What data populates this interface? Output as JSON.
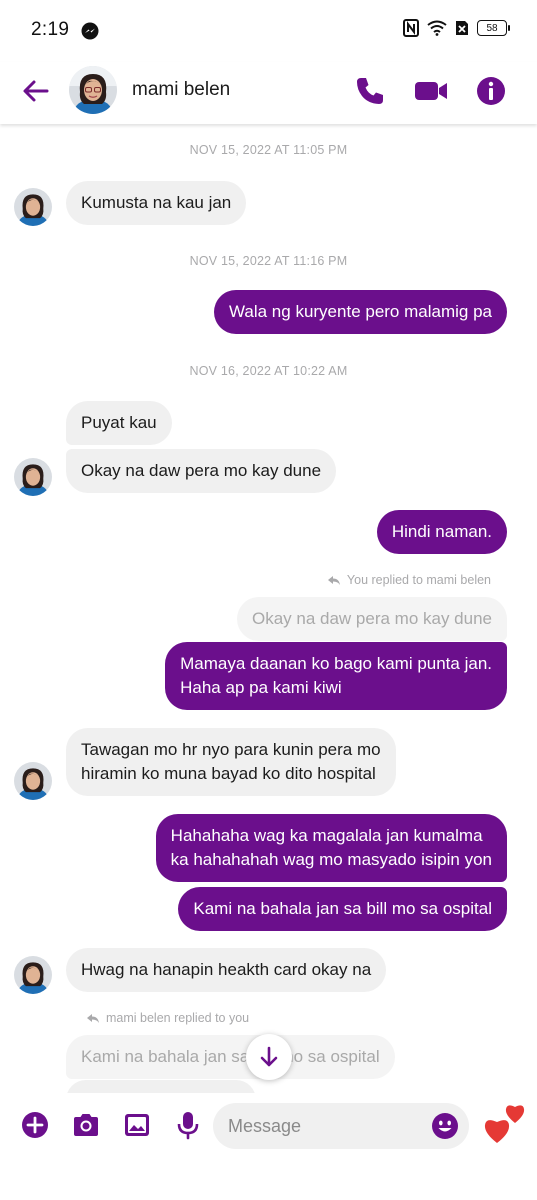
{
  "status_bar": {
    "time": "2:19",
    "battery": "58"
  },
  "header": {
    "contact_name": "mami belen"
  },
  "colors": {
    "accent": "#6b0f8c",
    "incoming_bubble": "#f0f0f0",
    "timestamp": "#a9a9ab"
  },
  "conversation": {
    "timestamps": [
      "NOV 15, 2022 AT 11:05 PM",
      "NOV 15, 2022 AT 11:16 PM",
      "NOV 16, 2022 AT 10:22 AM"
    ],
    "messages": [
      {
        "from": "contact",
        "text": "Kumusta na kau jan"
      },
      {
        "from": "me",
        "text": "Wala ng kuryente pero malamig pa"
      },
      {
        "from": "contact",
        "text": "Puyat kau"
      },
      {
        "from": "contact",
        "text": "Okay na daw pera mo kay dune"
      },
      {
        "from": "me",
        "text": "Hindi naman."
      },
      {
        "from": "me",
        "reply_label": "You replied to mami belen",
        "quoted": "Okay na daw pera mo kay dune",
        "lines": [
          "Mamaya daanan ko bago kami punta jan.",
          "Haha ap pa kami kiwi"
        ]
      },
      {
        "from": "contact",
        "lines": [
          "Tawagan mo hr nyo para kunin pera mo",
          "hiramin ko muna bayad ko dito hospital"
        ]
      },
      {
        "from": "me",
        "lines": [
          "Hahahaha wag ka magalala jan kumalma",
          "ka hahahahah wag mo masyado isipin yon"
        ]
      },
      {
        "from": "me",
        "text": "Kami na bahala jan sa bill mo sa ospital"
      },
      {
        "from": "contact",
        "text": "Hwag na hanapin heakth card okay na"
      },
      {
        "from": "contact",
        "reply_label": "mami belen replied to you",
        "quoted": "Kami na bahala jan sa bill mo sa ospital"
      }
    ]
  },
  "composer": {
    "placeholder": "Message"
  }
}
